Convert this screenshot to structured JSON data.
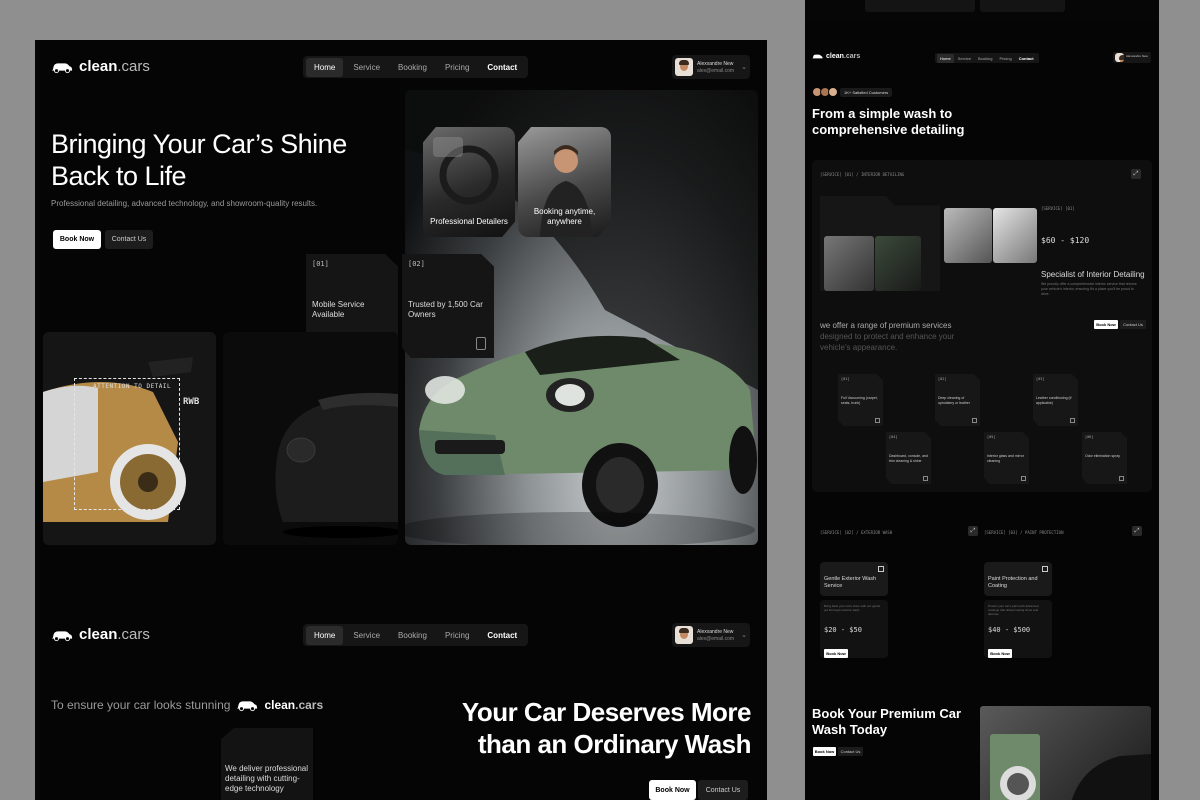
{
  "brand": {
    "name": "clean",
    "suffix": ".cars"
  },
  "nav": {
    "items": [
      {
        "label": "Home"
      },
      {
        "label": "Service"
      },
      {
        "label": "Booking"
      },
      {
        "label": "Pricing"
      },
      {
        "label": "Contact"
      }
    ]
  },
  "user": {
    "name": "Alexxandre New",
    "email": "alex@email.com"
  },
  "hero": {
    "title": "Bringing Your Car’s Shine Back to Life",
    "subtitle": "Professional detailing, advanced technology, and showroom-quality results.",
    "book_label": "Book Now",
    "contact_label": "Contact Us"
  },
  "photo_cards": [
    {
      "caption": "Professional Detailers"
    },
    {
      "caption": "Booking anytime, anywhere"
    }
  ],
  "info_cards": [
    {
      "num": "[01]",
      "text": "Mobile Service Available"
    },
    {
      "num": "[02]",
      "text": "Trusted by 1,500 Car Owners"
    }
  ],
  "attention_label": "ATTENTION TO DETAIL",
  "plate_text": "RWB",
  "section2": {
    "tagline": "To ensure your car looks stunning",
    "title": "Your Car Deserves More than an Ordinary Wash",
    "book_label": "Book Now",
    "contact_label": "Contact Us",
    "deliver_text": "We deliver professional detailing with cutting-edge technology"
  },
  "side": {
    "customers_badge": "1K+ Satisfied Customers",
    "heading": "From a simple wash to comprehensive detailing",
    "interior_tag": "[SERVICE] [01] / INTERIOR DETAILING",
    "interior_sub_tag": "[SERVICE] [01]",
    "interior_price": "$60 - $120",
    "interior_title": "Specialist of Interior Detailing",
    "interior_desc": "We proudly offer a comprehensive interior service that returns your vehicle's interior, ensuring it's a place you'll be proud to drive.",
    "offer_text": "we offer a range of premium services",
    "offer_dim": "designed to protect and enhance your vehicle’s appearance.",
    "book_label": "Book Now",
    "contact_label": "Contact Us",
    "service_cards": [
      {
        "num": "[01]",
        "text": "Full Vacuuming (carpet, seats, trunk)"
      },
      {
        "num": "[02]",
        "text": "Deep cleaning of upholstery or leather"
      },
      {
        "num": "[03]",
        "text": "Leather conditioning (if applicable)"
      },
      {
        "num": "[04]",
        "text": "Dashboard, console, and trim cleaning & shine"
      },
      {
        "num": "[05]",
        "text": "Interior glass and mirror cleaning"
      },
      {
        "num": "[06]",
        "text": "Odor elimination spray"
      }
    ],
    "exterior_tag": "[SERVICE] [02] / EXTERIOR WASH",
    "paint_tag": "[SERVICE] [03] / PAINT PROTECTION",
    "exterior_title": "Gentle Exterior Wash Service",
    "exterior_desc": "Bring back your car's shine with our gentle yet thorough exterior wash.",
    "exterior_price": "$20 - $50",
    "paint_title": "Paint Protection and Coating",
    "paint_desc": "Protect your car's paint with advanced coatings that deliver lasting shine and defense.",
    "paint_price": "$40 - $500",
    "book_heading": "Book Your Premium Car Wash Today"
  },
  "colors": {
    "bg": "#050505",
    "panel": "#161616",
    "car_green": "#6f8a6a",
    "car_gold": "#b58a46"
  }
}
